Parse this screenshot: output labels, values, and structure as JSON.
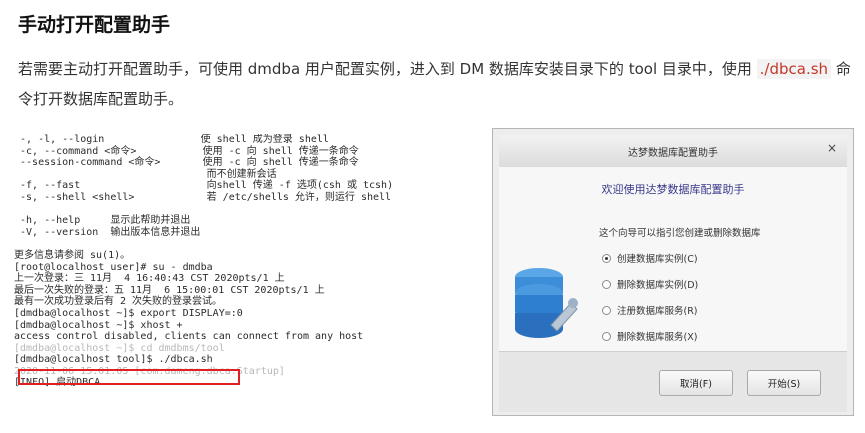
{
  "heading": "手动打开配置助手",
  "paragraph": {
    "part1": "若需要主动打开配置助手，可使用 dmdba 用户配置实例，进入到 DM 数据库安装目录下的 tool 目录中，使用 ",
    "code": "./dbca.sh",
    "part2": " 命令打开数据库配置助手。"
  },
  "terminal": {
    "lines": [
      " -, -l, --login                使 shell 成为登录 shell",
      " -c, --command <命令>           使用 -c 向 shell 传递一条命令",
      " --session-command <命令>       使用 -c 向 shell 传递一条命令",
      "                                而不创建新会话",
      " -f, --fast                     向shell 传递 -f 选项(csh 或 tcsh)",
      " -s, --shell <shell>            若 /etc/shells 允许，则运行 shell",
      "",
      " -h, --help     显示此帮助并退出",
      " -V, --version  输出版本信息并退出",
      "",
      "更多信息请参阅 su(1)。",
      "[root@localhost user]# su - dmdba",
      "上一次登录：三 11月  4 16:40:43 CST 2020pts/1 上",
      "最后一次失败的登录：五 11月  6 15:00:01 CST 2020pts/1 上",
      "最有一次成功登录后有 2 次失败的登录尝试。",
      "[dmdba@localhost ~]$ export DISPLAY=:0",
      "[dmdba@localhost ~]$ xhost +",
      "access control disabled, clients can connect from any host",
      "[dmdba@localhost ~]$ cd dmdbms/tool",
      "[dmdba@localhost tool]$ ./dbca.sh",
      "2020-11-06 15:01:05 [com.dameng.dbca.Startup]",
      "[INFO] 启动DBCA"
    ]
  },
  "installer": {
    "title": "达梦数据库配置助手",
    "close_label": "×",
    "welcome": "欢迎使用达梦数据库配置助手",
    "intro": "这个向导可以指引您创建或删除数据库",
    "options": [
      "创建数据库实例(C)",
      "删除数据库实例(D)",
      "注册数据库服务(R)",
      "删除数据库服务(X)"
    ],
    "selected_option_index": 0,
    "cancel_label": "取消(F)",
    "start_label": "开始(S)",
    "accent_color": "#2f7fd0"
  }
}
